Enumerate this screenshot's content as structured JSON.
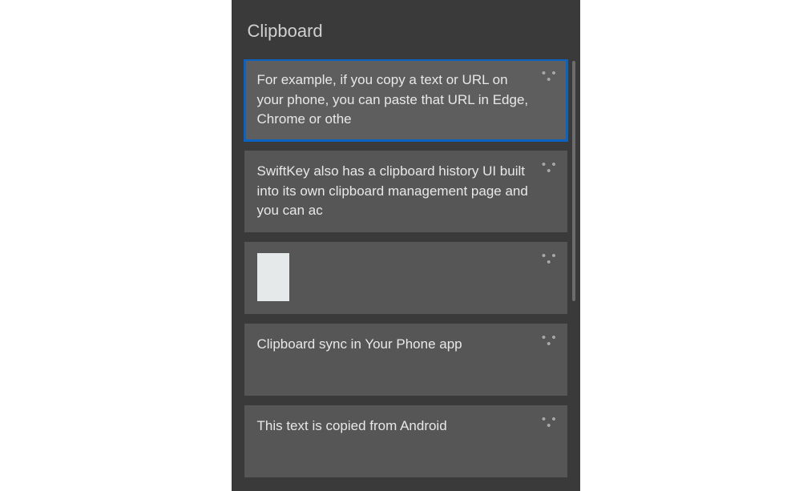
{
  "panel": {
    "title": "Clipboard"
  },
  "items": [
    {
      "text": "For example, if you copy a text or URL on your phone, you can paste that URL in Edge, Chrome or othe",
      "type": "text",
      "selected": true
    },
    {
      "text": "SwiftKey also has a clipboard history UI built into its own clipboard management page and you can ac",
      "type": "text",
      "selected": false
    },
    {
      "text": "",
      "type": "image",
      "selected": false
    },
    {
      "text": "Clipboard sync in Your Phone app",
      "type": "text",
      "selected": false
    },
    {
      "text": "This text is copied from Android",
      "type": "text",
      "selected": false
    }
  ],
  "icons": {
    "more": "• • •"
  }
}
